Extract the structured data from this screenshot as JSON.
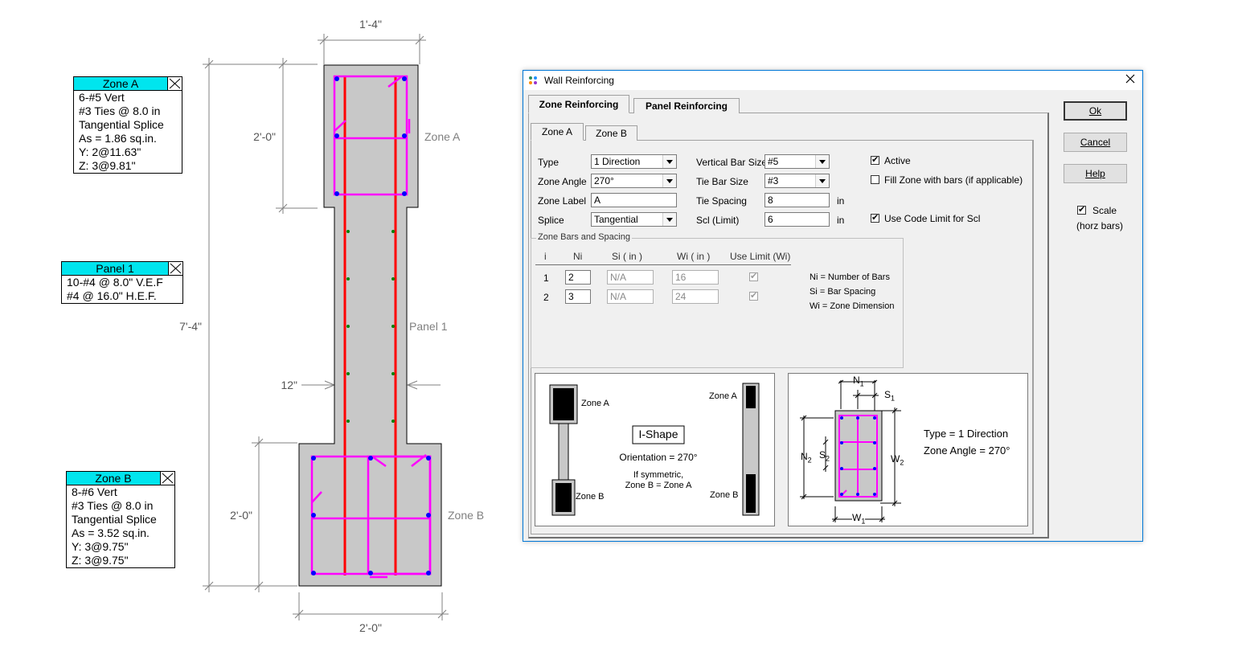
{
  "drawing": {
    "dims": {
      "top_width": "1'-4\"",
      "zone_a_height": "2'-0\"",
      "total_height": "7'-4\"",
      "web_thickness": "12\"",
      "zone_b_height": "2'-0\"",
      "bottom_width": "2'-0\""
    },
    "zone_labels": {
      "zone_a": "Zone A",
      "panel_1": "Panel 1",
      "zone_b": "Zone B"
    },
    "colors": {
      "concrete": "#c8c8c8",
      "ties": "#ff00ff",
      "vert_bars": "#0000ff",
      "horiz_bars": "#ff0000",
      "panel_bars": "#008000"
    }
  },
  "info_boxes": {
    "zone_a": {
      "title": "Zone A",
      "lines": [
        "6-#5 Vert",
        "#3 Ties @ 8.0 in",
        "Tangential Splice",
        "As = 1.86 sq.in.",
        "Y: 2@11.63\"",
        "Z: 3@9.81\""
      ]
    },
    "panel_1": {
      "title": "Panel 1",
      "lines": [
        "10-#4 @ 8.0\" V.E.F",
        "#4 @ 16.0\" H.E.F."
      ]
    },
    "zone_b": {
      "title": "Zone B",
      "lines": [
        "8-#6 Vert",
        "#3 Ties @ 8.0 in",
        "Tangential Splice",
        "As = 3.52 sq.in.",
        "Y: 3@9.75\"",
        "Z: 3@9.75\""
      ]
    }
  },
  "dialog": {
    "title": "Wall Reinforcing",
    "close_icon": "close-icon",
    "outer_tabs": [
      "Zone Reinforcing",
      "Panel Reinforcing"
    ],
    "inner_tabs": [
      "Zone A",
      "Zone B"
    ],
    "form": {
      "type_label": "Type",
      "type_value": "1 Direction",
      "zone_angle_label": "Zone Angle",
      "zone_angle_value": "270°",
      "zone_label_label": "Zone Label",
      "zone_label_value": "A",
      "splice_label": "Splice",
      "splice_value": "Tangential",
      "vert_bar_size_label": "Vertical Bar Size",
      "vert_bar_size_value": "#5",
      "tie_bar_size_label": "Tie Bar Size",
      "tie_bar_size_value": "#3",
      "tie_spacing_label": "Tie Spacing",
      "tie_spacing_value": "8",
      "tie_spacing_unit": "in",
      "scl_label": "Scl (Limit)",
      "scl_value": "6",
      "scl_unit": "in",
      "active_label": "Active",
      "active_checked": "✔",
      "fill_zone_label": "Fill Zone with bars (if applicable)",
      "use_code_limit_label": "Use Code Limit for Scl",
      "use_code_limit_checked": "✔"
    },
    "zone_bars": {
      "group_title": "Zone Bars and Spacing",
      "headers": [
        "i",
        "Ni",
        "Si  (  in  )",
        "Wi  (  in  )",
        "Use Limit (Wi)"
      ],
      "rows": [
        {
          "i": "1",
          "ni": "2",
          "si": "N/A",
          "wi": "16",
          "use_limit": "✔"
        },
        {
          "i": "2",
          "ni": "3",
          "si": "N/A",
          "wi": "24",
          "use_limit": "✔"
        }
      ],
      "legend": [
        "Ni = Number of Bars",
        "Si = Bar Spacing",
        "Wi = Zone Dimension"
      ]
    },
    "preview_left": {
      "zone_a_left": "Zone A",
      "zone_b_left": "Zone B",
      "shape": "I-Shape",
      "orientation": "Orientation = 270°",
      "note_1": "If symmetric,",
      "note_2": "Zone B = Zone A",
      "zone_a_right": "Zone A",
      "zone_b_right": "Zone B"
    },
    "preview_right": {
      "n1": "N",
      "n1_sub": "1",
      "s1": "S",
      "s1_sub": "1",
      "n2": "N",
      "n2_sub": "2",
      "s2": "S",
      "s2_sub": "2",
      "w2": "W",
      "w2_sub": "2",
      "w1": "W",
      "w1_sub": "1",
      "type_text": "Type = 1 Direction",
      "angle_text": "Zone Angle = 270°"
    },
    "buttons": {
      "ok": "Ok",
      "cancel": "Cancel",
      "help": "Help"
    },
    "scale": {
      "label": "Scale",
      "sub": "(horz bars)",
      "checked": "✔"
    }
  }
}
